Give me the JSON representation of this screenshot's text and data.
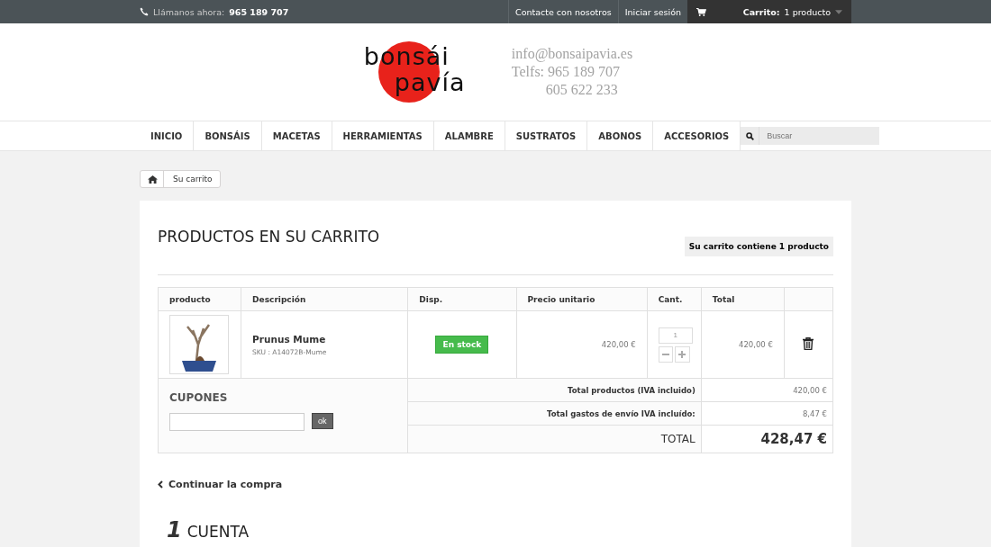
{
  "top_bar": {
    "call_label": "Llámanos ahora:",
    "phone": "965 189 707",
    "links": [
      "Contacte con nosotros",
      "Iniciar sesión"
    ],
    "cart_label": "Carrito:",
    "cart_count": "1 producto"
  },
  "header": {
    "logo_top": "bonsái",
    "logo_bottom": "pavía",
    "contact_lines": [
      "info@bonsaipavia.es",
      "Telfs: 965 189 707",
      "605 622 233"
    ]
  },
  "nav": {
    "items": [
      "INICIO",
      "BONSÁIS",
      "MACETAS",
      "HERRAMIENTAS",
      "ALAMBRE",
      "SUSTRATOS",
      "ABONOS",
      "ACCESORIOS"
    ],
    "search_placeholder": "Buscar"
  },
  "breadcrumb": {
    "current": "Su carrito"
  },
  "cart": {
    "title": "PRODUCTOS EN SU CARRITO",
    "summary_badge": "Su carrito contiene 1 producto",
    "columns": [
      "producto",
      "Descripción",
      "Disp.",
      "Precio unitario",
      "Cant.",
      "Total"
    ],
    "rows": [
      {
        "name": "Prunus Mume",
        "sku": "SKU : A14072B-Mume",
        "availability": "En stock",
        "unit_price": "420,00 €",
        "quantity": "1",
        "total": "420,00 €"
      }
    ],
    "coupons": {
      "title": "CUPONES",
      "button": "ok"
    },
    "totals": [
      {
        "label": "Total productos (IVA incluido)",
        "value": "420,00 €",
        "kind": "line"
      },
      {
        "label": "Total gastos de envío IVA incluído:",
        "value": "8,47 €",
        "kind": "line"
      },
      {
        "label": "TOTAL",
        "value": "428,47 €",
        "kind": "grand"
      }
    ],
    "continue_link": "Continuar la compra"
  },
  "step": {
    "number": "1",
    "title": "CUENTA"
  }
}
